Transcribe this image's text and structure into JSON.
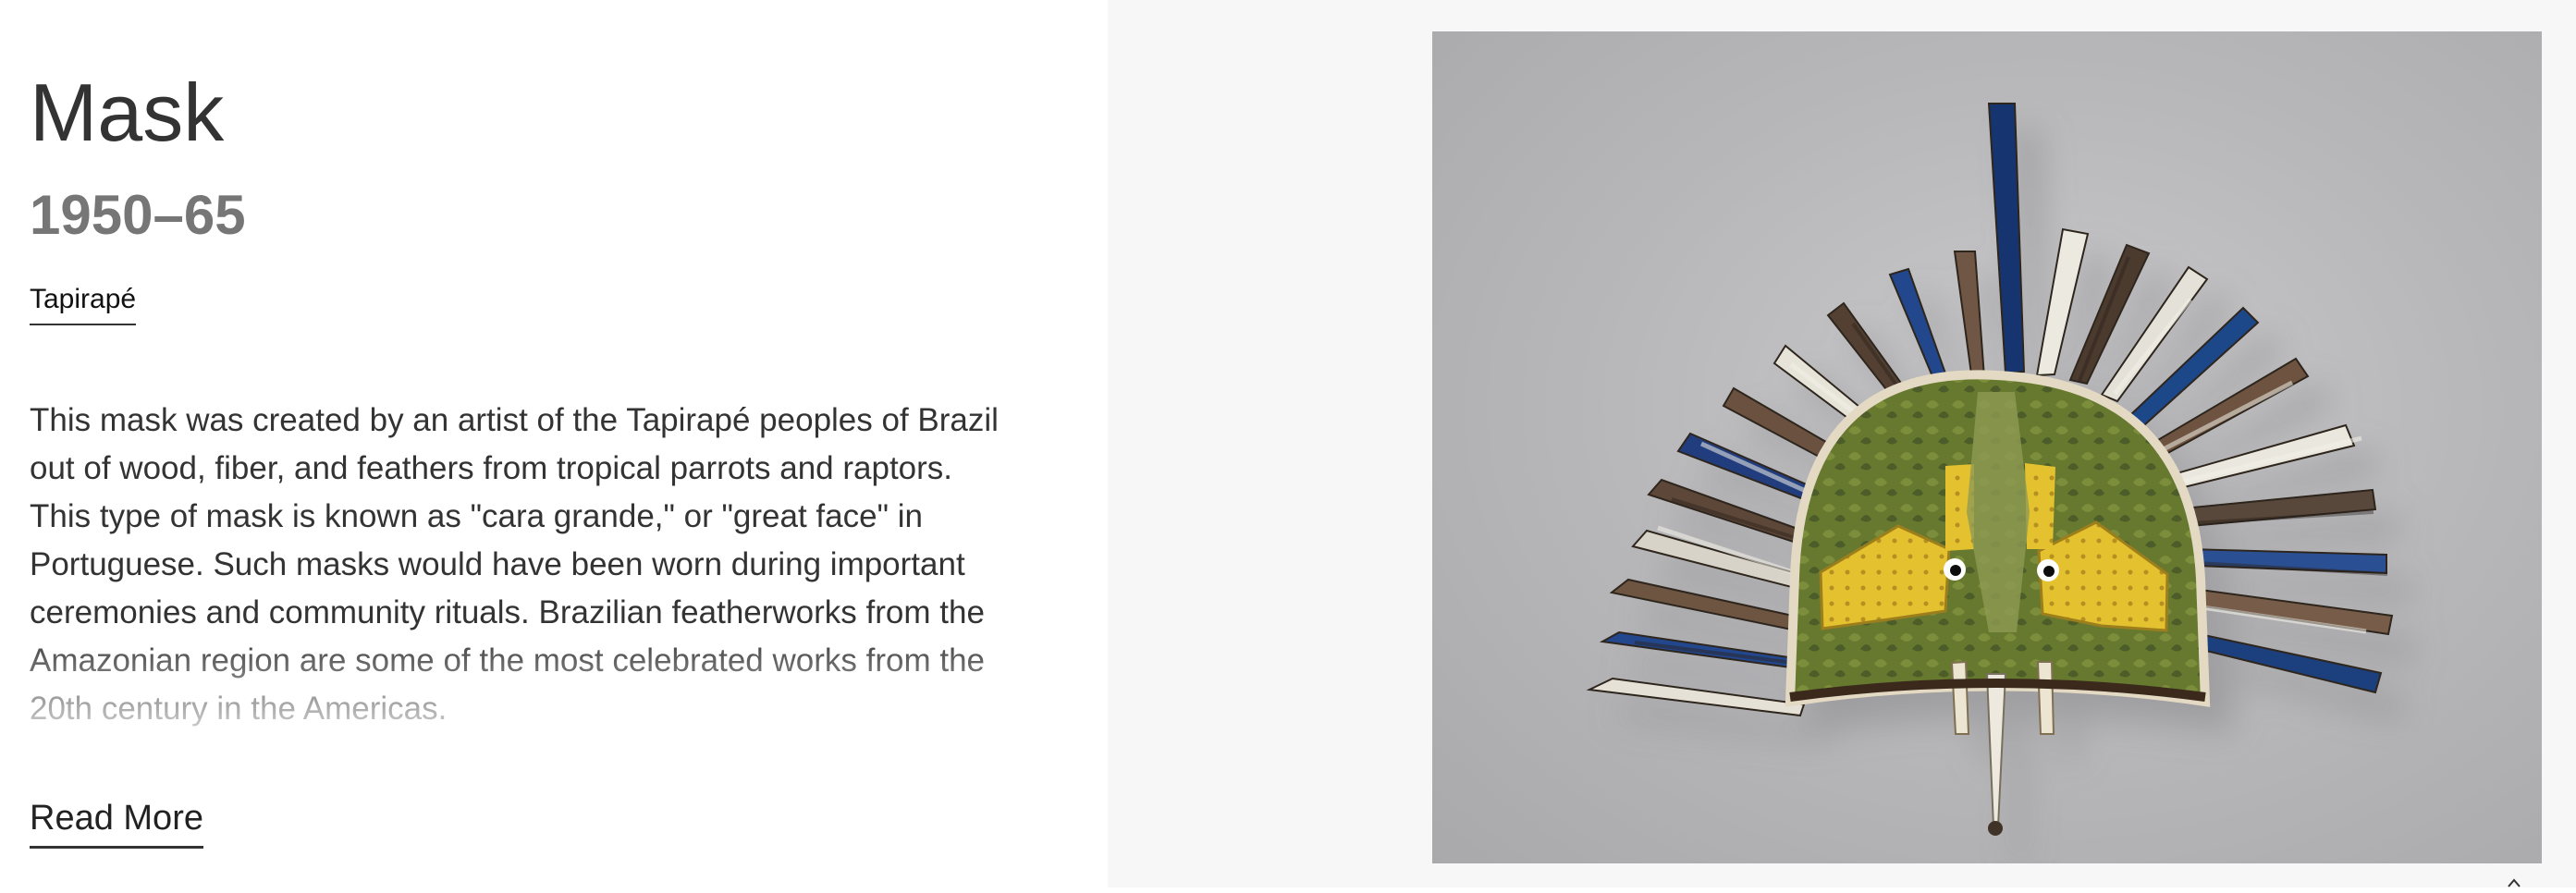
{
  "artwork": {
    "title": "Mask",
    "date": "1950–65",
    "culture": "Tapirapé",
    "description": "This mask was created by an artist of the Tapirapé peoples of Brazil out of wood, fiber, and feathers from tropical parrots and raptors. This type of mask is known as \"cara grande,\" or \"great face\" in Portuguese. Such masks would have been worn during important ceremonies and community rituals. Brazilian featherworks from the Amazonian region are some of the most celebrated works from the 20th century in the Americas.",
    "read_more": "Read More",
    "image_icon": "feathered-mask-image",
    "image_alt": "Feathered mask with blue, white and brown feathers and yellow-green featherwork face"
  },
  "colors": {
    "blue_feather": "#22468c",
    "white_feather": "#e6e4dc",
    "brown_feather": "#5a4536",
    "yellow_featherwork": "#e4c12f",
    "green_featherwork": "#637a2f"
  }
}
